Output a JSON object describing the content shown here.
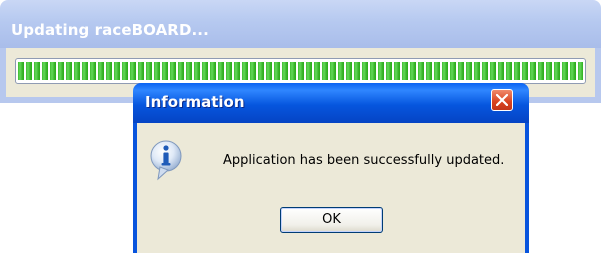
{
  "updater": {
    "title": "Updating raceBOARD...",
    "progress_fraction": 1.0
  },
  "dialog": {
    "title": "Information",
    "message": "Application has been successfully updated.",
    "ok_label": "OK",
    "icon": "info-icon"
  },
  "colors": {
    "dialog_titlebar": "#0654de",
    "close_button": "#d8421f",
    "progress_green": "#3fbc2f",
    "dialog_face": "#ece9d8"
  }
}
